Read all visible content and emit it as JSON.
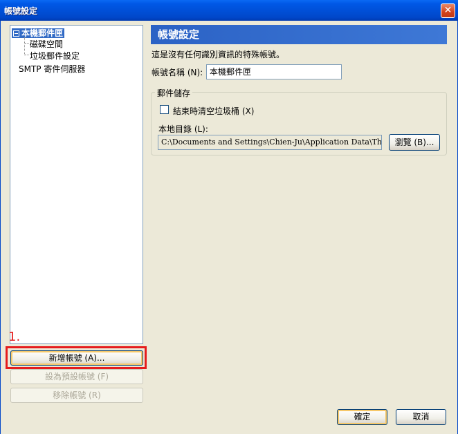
{
  "window": {
    "title": "帳號設定",
    "close_glyph": "✕"
  },
  "tree": {
    "items": [
      {
        "label": "本機郵件匣"
      },
      {
        "label": "磁碟空間"
      },
      {
        "label": "垃圾郵件設定"
      },
      {
        "label": "SMTP 寄件伺服器"
      }
    ]
  },
  "annotation": {
    "step": "1."
  },
  "left_buttons": {
    "add": "新增帳號 (A)...",
    "set_default": "設為預設帳號 (F)",
    "remove": "移除帳號 (R)"
  },
  "panel": {
    "header": "帳號設定",
    "description": "這是沒有任何識別資訊的特殊帳號。",
    "account_name_label": "帳號名稱 (N):",
    "account_name_value": "本機郵件匣",
    "storage_group_label": "郵件儲存",
    "empty_trash_label": "結束時清空垃圾桶 (X)",
    "empty_trash_checked": false,
    "local_dir_label": "本地目錄 (L):",
    "local_dir_value": "C:\\Documents and Settings\\Chien-Ju\\Application Data\\Thunderbird\\",
    "browse_button": "瀏覽 (B)..."
  },
  "footer": {
    "ok": "確定",
    "cancel": "取消"
  },
  "colors": {
    "title_bar": "#0054e3",
    "selection": "#316ac5",
    "annotation_red": "#e51c1c"
  }
}
